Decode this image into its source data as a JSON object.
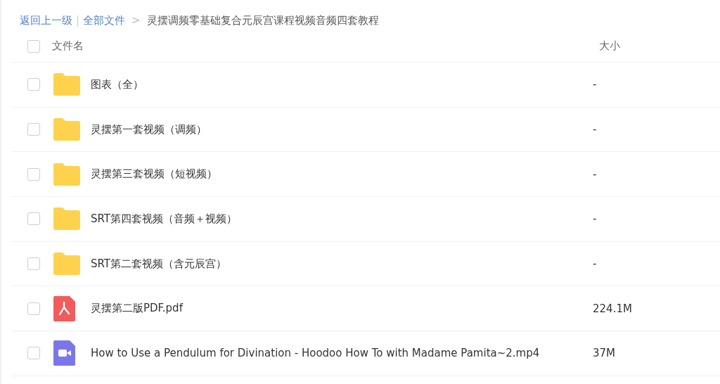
{
  "breadcrumb": {
    "back": "返回上一级",
    "divider": "|",
    "root": "全部文件",
    "separator": ">",
    "current": "灵摆调频零基础复合元辰宫课程视频音频四套教程"
  },
  "table": {
    "select_all": {
      "checked": false
    },
    "columns": [
      "文件名",
      "大小"
    ],
    "rows": [
      {
        "kind": "folder",
        "name": "图表（全）",
        "size": "-",
        "checked": false
      },
      {
        "kind": "folder",
        "name": "灵摆第一套视频（调频）",
        "size": "-",
        "checked": false
      },
      {
        "kind": "folder",
        "name": "灵摆第三套视频（短视频）",
        "size": "-",
        "checked": false
      },
      {
        "kind": "folder",
        "name": "SRT第四套视频（音频＋视频）",
        "size": "-",
        "checked": false
      },
      {
        "kind": "folder",
        "name": "SRT第二套视频（含元辰宫）",
        "size": "-",
        "checked": false
      },
      {
        "kind": "pdf",
        "name": "灵摆第二版PDF.pdf",
        "size": "224.1M",
        "checked": false
      },
      {
        "kind": "video",
        "name": "How to Use a Pendulum for Divination - Hoodoo How To with Madame Pamita~2.mp4",
        "size": "37M",
        "checked": false
      }
    ]
  }
}
